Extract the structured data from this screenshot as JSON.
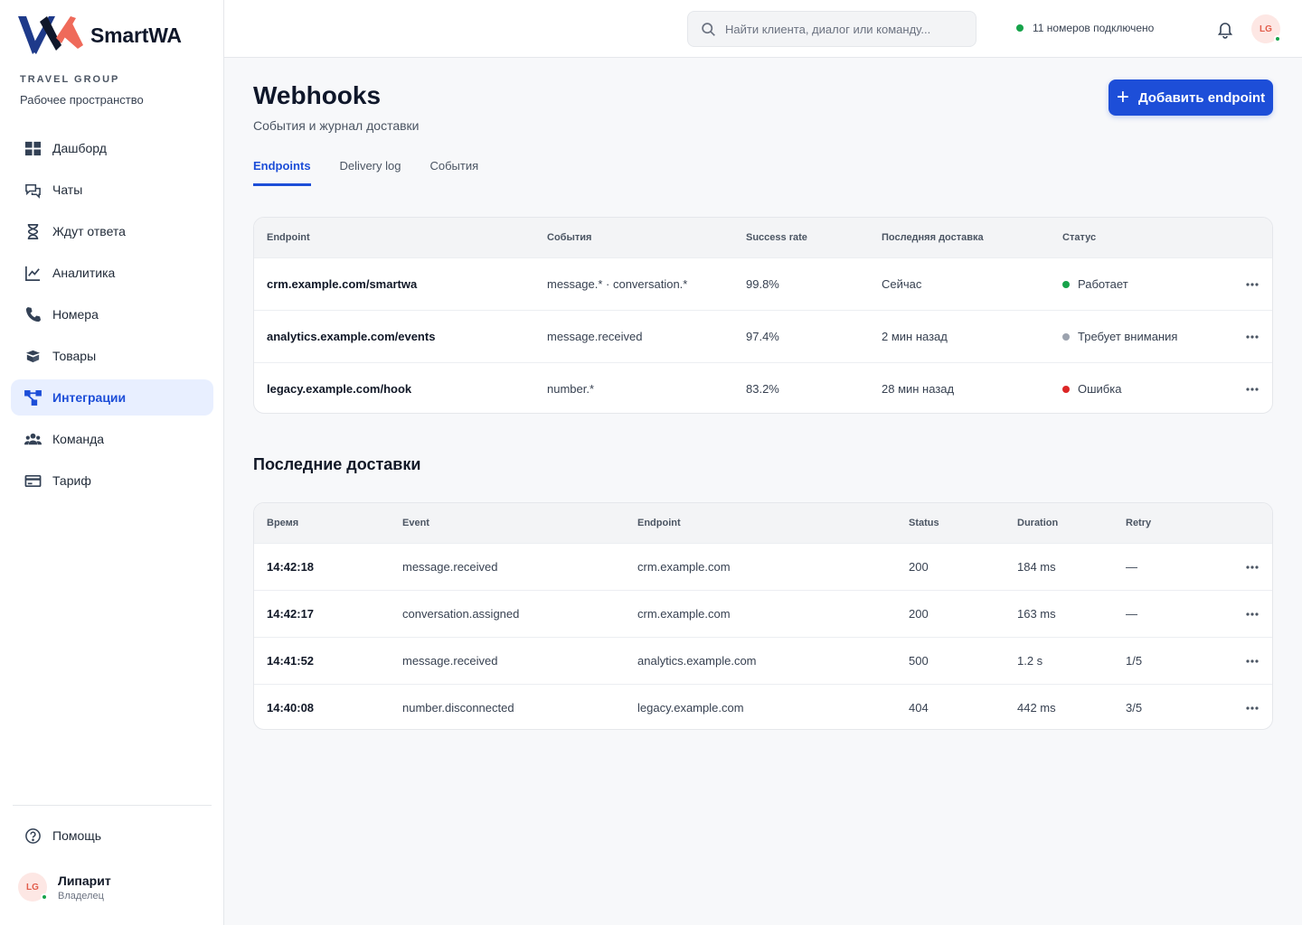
{
  "app": {
    "name": "SmartWA",
    "workspace_label": "TRAVEL GROUP",
    "workspace_name": "Рабочее пространство"
  },
  "sidebar": {
    "items": [
      {
        "label": "Дашборд",
        "icon": "dashboard-icon"
      },
      {
        "label": "Чаты",
        "icon": "chats-icon"
      },
      {
        "label": "Ждут ответа",
        "icon": "hourglass-icon"
      },
      {
        "label": "Аналитика",
        "icon": "chart-icon"
      },
      {
        "label": "Номера",
        "icon": "phone-icon"
      },
      {
        "label": "Товары",
        "icon": "box-icon"
      },
      {
        "label": "Интеграции",
        "icon": "integrations-icon",
        "active": true
      },
      {
        "label": "Команда",
        "icon": "team-icon"
      },
      {
        "label": "Тариф",
        "icon": "card-icon"
      }
    ],
    "help_label": "Помощь",
    "user": {
      "initials": "LG",
      "name": "Липарит",
      "role": "Владелец"
    }
  },
  "topbar": {
    "search_placeholder": "Найти клиента, диалог или команду...",
    "connection_status": "11 номеров подключено",
    "avatar_initials": "LG"
  },
  "page": {
    "title": "Webhooks",
    "subtitle": "События и журнал доставки",
    "add_button": "Добавить endpoint"
  },
  "tabs": [
    {
      "label": "Endpoints",
      "active": true
    },
    {
      "label": "Delivery log"
    },
    {
      "label": "События"
    }
  ],
  "endpoints": {
    "headers": [
      "Endpoint",
      "События",
      "Success rate",
      "Последняя доставка",
      "Статус"
    ],
    "rows": [
      {
        "endpoint": "crm.example.com/smartwa",
        "events": "message.* · conversation.*",
        "rate": "99.8%",
        "last": "Сейчас",
        "status": "Работает",
        "color": "#16a34a"
      },
      {
        "endpoint": "analytics.example.com/events",
        "events": "message.received",
        "rate": "97.4%",
        "last": "2 мин назад",
        "status": "Требует внимания",
        "color": "#9ca3af"
      },
      {
        "endpoint": "legacy.example.com/hook",
        "events": "number.*",
        "rate": "83.2%",
        "last": "28 мин назад",
        "status": "Ошибка",
        "color": "#dc2626"
      }
    ]
  },
  "deliveries": {
    "title": "Последние доставки",
    "headers": [
      "Время",
      "Event",
      "Endpoint",
      "Status",
      "Duration",
      "Retry"
    ],
    "rows": [
      {
        "time": "14:42:18",
        "event": "message.received",
        "endpoint": "crm.example.com",
        "status": "200",
        "duration": "184 ms",
        "retry": "—"
      },
      {
        "time": "14:42:17",
        "event": "conversation.assigned",
        "endpoint": "crm.example.com",
        "status": "200",
        "duration": "163 ms",
        "retry": "—"
      },
      {
        "time": "14:41:52",
        "event": "message.received",
        "endpoint": "analytics.example.com",
        "status": "500",
        "duration": "1.2 s",
        "retry": "1/5"
      },
      {
        "time": "14:40:08",
        "event": "number.disconnected",
        "endpoint": "legacy.example.com",
        "status": "404",
        "duration": "442 ms",
        "retry": "3/5"
      }
    ]
  },
  "colors": {
    "accent": "#1d4ed8",
    "success": "#16a34a",
    "warning": "#9ca3af",
    "error": "#dc2626"
  }
}
